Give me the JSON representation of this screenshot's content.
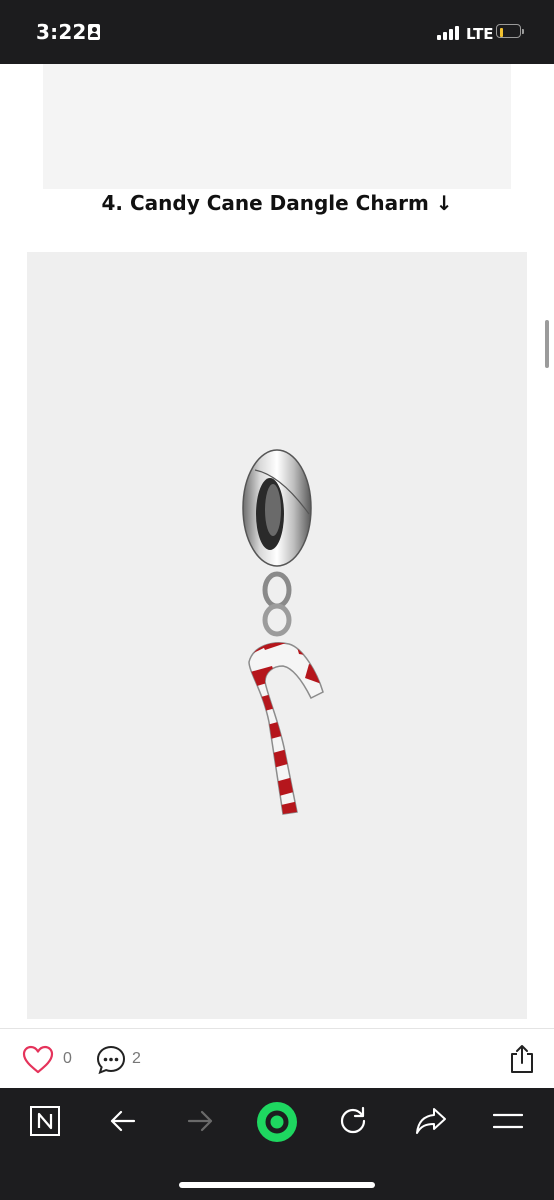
{
  "status_bar": {
    "time": "3:22",
    "network": "LTE",
    "icons": [
      "contact-card-icon",
      "signal-icon",
      "battery-icon"
    ]
  },
  "content": {
    "caption": "4. Candy Cane Dangle Charm ↓",
    "image_description_icon": "candy-cane-charm"
  },
  "actions": {
    "like_count": "0",
    "comment_count": "2",
    "icons": [
      "heart-icon",
      "comment-icon",
      "share-icon"
    ]
  },
  "toolbar": {
    "icons": [
      "naver-home-icon",
      "back-arrow-icon",
      "forward-arrow-icon",
      "green-circle-icon",
      "refresh-icon",
      "share-arrow-icon",
      "menu-icon"
    ],
    "accent_color": "#1ed760"
  }
}
